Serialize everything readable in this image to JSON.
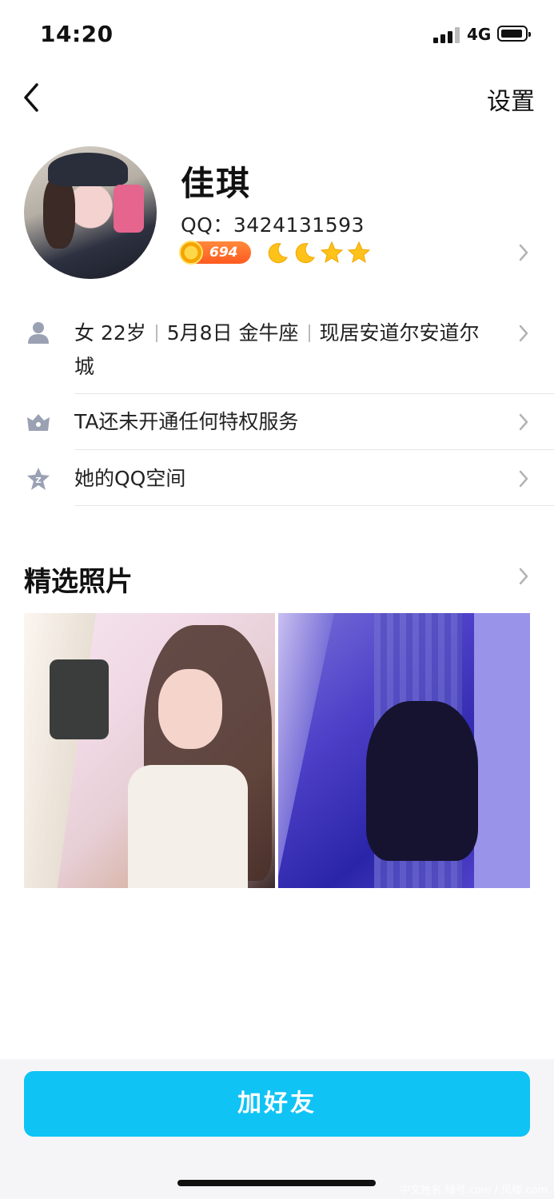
{
  "status_bar": {
    "time": "14:20",
    "network": "4G"
  },
  "nav": {
    "settings_label": "设置"
  },
  "profile": {
    "name": "佳琪",
    "qq_label": "QQ：3424131593",
    "coin_level": "694",
    "level_icons": [
      "moon-icon",
      "moon-icon",
      "star-icon",
      "star-icon"
    ]
  },
  "info": {
    "basic": {
      "gender": "女",
      "age": "22岁",
      "birthday": "5月8日 金牛座",
      "location": "现居安道尔安道尔城"
    },
    "privilege": "TA还未开通任何特权服务",
    "qzone": "她的QQ空间"
  },
  "photos": {
    "title": "精选照片",
    "items": [
      "photo-1",
      "photo-2"
    ]
  },
  "actions": {
    "add_friend_label": "加好友"
  },
  "watermark": "中文姓名.绰号.com / 风楼.com",
  "colors": {
    "accent": "#10c3f5",
    "badge": "#ff6a2a",
    "icon_gray": "#9aa1b3",
    "star": "#ffc21a"
  }
}
